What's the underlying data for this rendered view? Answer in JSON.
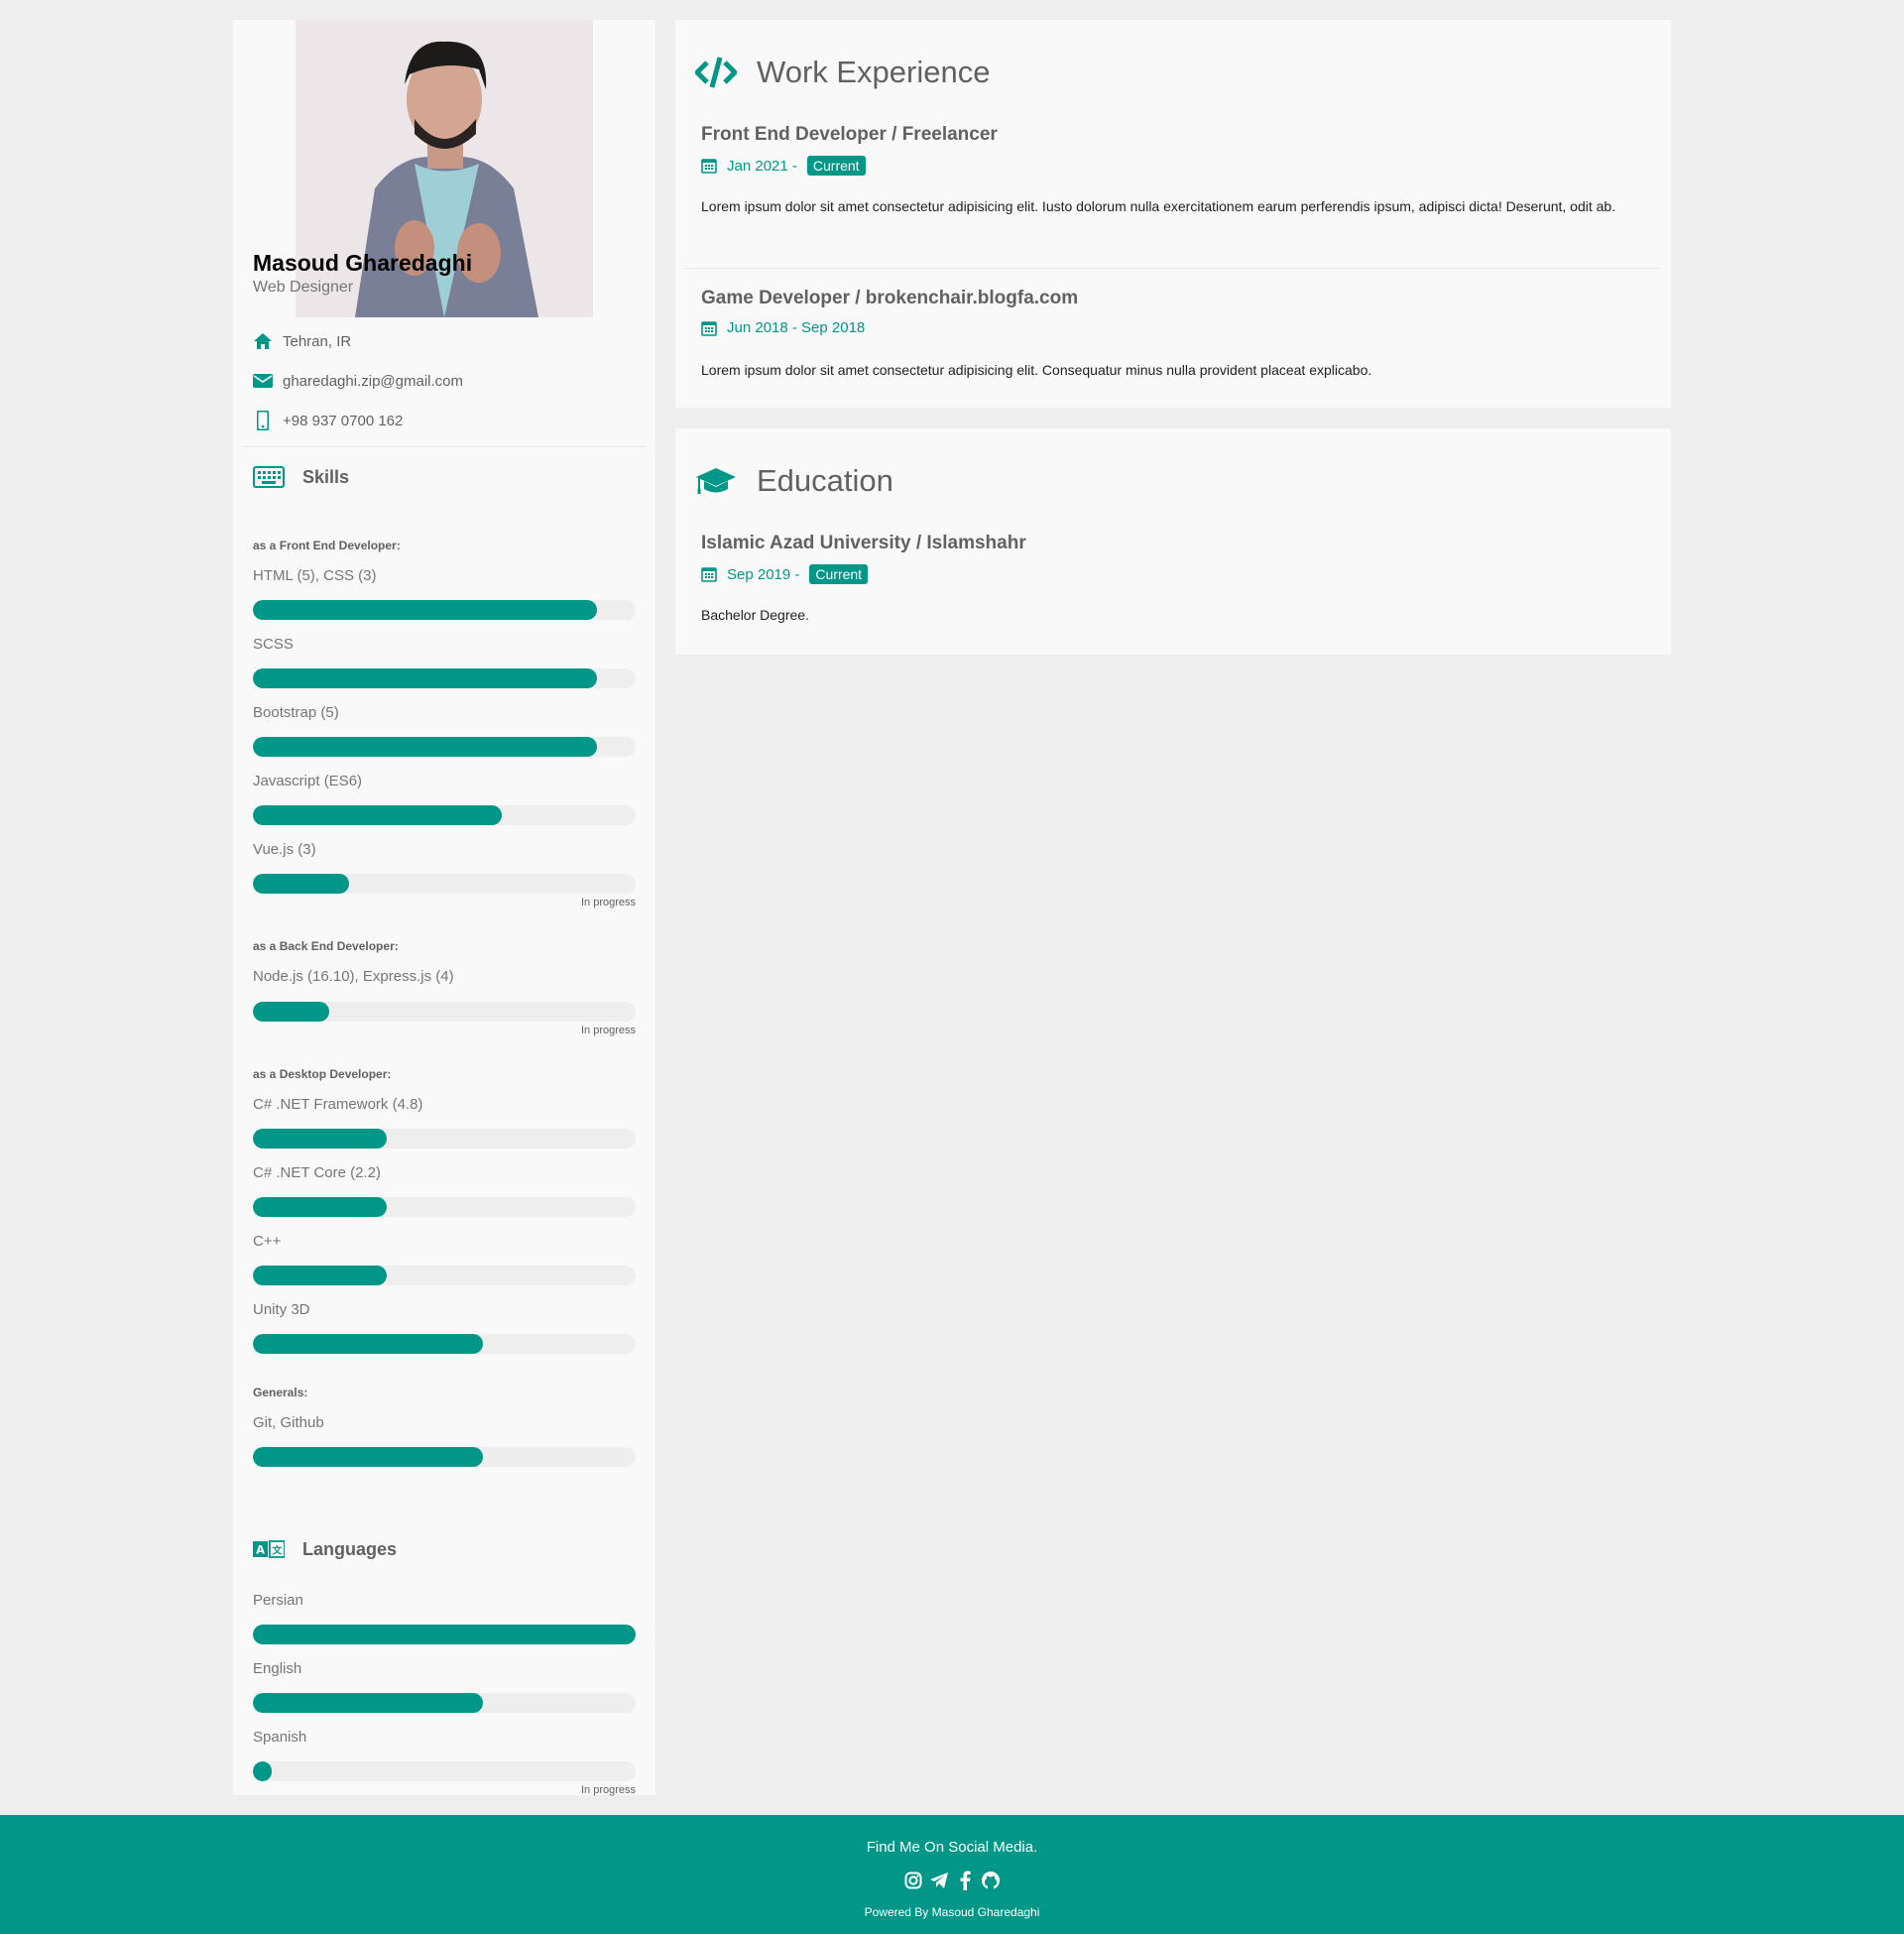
{
  "profile": {
    "name": "Masoud Gharedaghi",
    "role": "Web Designer",
    "location": "Tehran, IR",
    "email": "gharedaghi.zip@gmail.com",
    "phone": "+98 937 0700 162"
  },
  "skills": {
    "title": "Skills",
    "groups": [
      {
        "label": "as a Front End Developer:",
        "items": [
          {
            "name": "HTML (5), CSS (3)",
            "level": 90
          },
          {
            "name": "SCSS",
            "level": 90
          },
          {
            "name": "Bootstrap (5)",
            "level": 90
          },
          {
            "name": "Javascript (ES6)",
            "level": 65
          },
          {
            "name": "Vue.js (3)",
            "level": 25,
            "note": "In progress"
          }
        ]
      },
      {
        "label": "as a Back End Developer:",
        "items": [
          {
            "name": "Node.js (16.10), Express.js (4)",
            "level": 20,
            "note": "In progress"
          }
        ]
      },
      {
        "label": "as a Desktop Developer:",
        "items": [
          {
            "name": "C# .NET Framework (4.8)",
            "level": 35
          },
          {
            "name": "C# .NET Core (2.2)",
            "level": 35
          },
          {
            "name": "C++",
            "level": 35
          },
          {
            "name": "Unity 3D",
            "level": 60
          }
        ]
      },
      {
        "label": "Generals:",
        "items": [
          {
            "name": "Git, Github",
            "level": 60
          }
        ]
      }
    ]
  },
  "languages": {
    "title": "Languages",
    "items": [
      {
        "name": "Persian",
        "level": 100
      },
      {
        "name": "English",
        "level": 60
      },
      {
        "name": "Spanish",
        "level": 5,
        "note": "In progress"
      }
    ]
  },
  "work": {
    "title": "Work Experience",
    "jobs": [
      {
        "title": "Front End Developer / Freelancer",
        "date": "Jan 2021 -",
        "tag": "Current",
        "desc": "Lorem ipsum dolor sit amet consectetur adipisicing elit. Iusto dolorum nulla exercitationem earum perferendis ipsum, adipisci dicta! Deserunt, odit ab."
      },
      {
        "title": "Game Developer / brokenchair.blogfa.com",
        "date": "Jun 2018 - Sep 2018",
        "desc": "Lorem ipsum dolor sit amet consectetur adipisicing elit. Consequatur minus nulla provident placeat explicabo."
      }
    ]
  },
  "education": {
    "title": "Education",
    "items": [
      {
        "title": "Islamic Azad University / Islamshahr",
        "date": "Sep 2019 -",
        "tag": "Current",
        "desc": "Bachelor Degree."
      }
    ]
  },
  "footer": {
    "title": "Find Me On Social Media.",
    "powered": "Powered By Masoud Gharedaghi",
    "icons": [
      "instagram-icon",
      "telegram-icon",
      "facebook-icon",
      "github-icon"
    ]
  },
  "colors": {
    "accent": "#009688",
    "page_bg": "#eeeeee",
    "card_bg": "#f9f9f9"
  }
}
